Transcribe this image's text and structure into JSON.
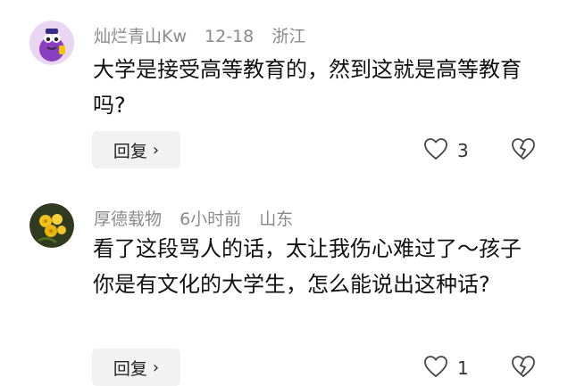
{
  "comments": [
    {
      "username": "灿烂青山Kw",
      "date": "12-18",
      "location": "浙江",
      "text": "大学是接受高等教育的，然到这就是高等教育吗?",
      "reply_label": "回复",
      "likes": "3",
      "avatar_icon": "purple-cartoon-avatar-icon"
    },
    {
      "username": "厚德载物",
      "date": "6小时前",
      "location": "山东",
      "text": "看了这段骂人的话，太让我伤心难过了～孩子你是有文化的大学生，怎么能说出这种话?",
      "reply_label": "回复",
      "likes": "1",
      "avatar_icon": "yellow-flower-avatar-icon"
    }
  ],
  "icons": {
    "like": "heart-outline-icon",
    "dislike": "broken-heart-icon",
    "reply_chevron": "chevron-right-icon"
  }
}
